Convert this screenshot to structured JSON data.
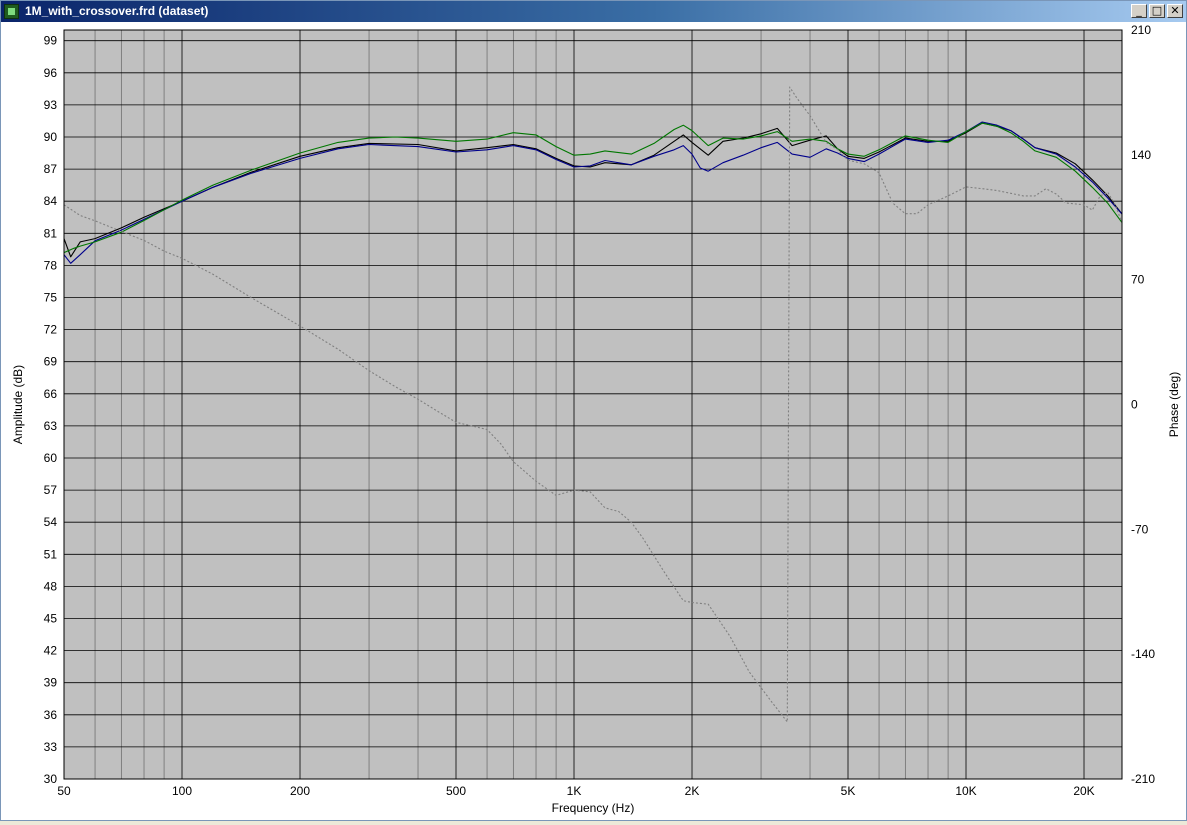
{
  "window": {
    "title": "1M_with_crossover.frd (dataset)",
    "controls": {
      "minimize": "_",
      "maximize": "□",
      "close": "✕"
    }
  },
  "colors": {
    "plot_background": "#c0c0c0",
    "grid": "#000000",
    "series_black": "#000000",
    "series_blue": "#00008b",
    "series_green": "#007700",
    "phase": "#808080"
  },
  "chart_data": {
    "type": "line",
    "xscale": "log",
    "xlabel": "Frequency (Hz)",
    "ylabel": "Amplitude (dB)",
    "y2label": "Phase (deg)",
    "xlim": [
      50,
      25000
    ],
    "ylim": [
      30,
      100
    ],
    "y2lim": [
      -210,
      210
    ],
    "grid": true,
    "x_ticks": [
      {
        "v": 50,
        "label": "50"
      },
      {
        "v": 100,
        "label": "100"
      },
      {
        "v": 200,
        "label": "200"
      },
      {
        "v": 500,
        "label": "500"
      },
      {
        "v": 1000,
        "label": "1K"
      },
      {
        "v": 2000,
        "label": "2K"
      },
      {
        "v": 5000,
        "label": "5K"
      },
      {
        "v": 10000,
        "label": "10K"
      },
      {
        "v": 20000,
        "label": "20K"
      }
    ],
    "x_minor": [
      60,
      70,
      80,
      90,
      300,
      400,
      600,
      700,
      800,
      900,
      3000,
      4000,
      6000,
      7000,
      8000,
      9000
    ],
    "y_ticks": [
      30,
      33,
      36,
      39,
      42,
      45,
      48,
      51,
      54,
      57,
      60,
      63,
      66,
      69,
      72,
      75,
      78,
      81,
      84,
      87,
      90,
      93,
      96,
      99
    ],
    "y2_ticks": [
      -210,
      -140,
      -70,
      0,
      70,
      140,
      210
    ],
    "series": [
      {
        "key": "black",
        "dashed": false,
        "points": [
          [
            50,
            80.5
          ],
          [
            52,
            78.8
          ],
          [
            55,
            80.2
          ],
          [
            60,
            80.5
          ],
          [
            70,
            81.5
          ],
          [
            80,
            82.5
          ],
          [
            90,
            83.3
          ],
          [
            100,
            84.0
          ],
          [
            120,
            85.3
          ],
          [
            150,
            86.7
          ],
          [
            200,
            88.2
          ],
          [
            250,
            89.0
          ],
          [
            300,
            89.4
          ],
          [
            400,
            89.3
          ],
          [
            500,
            88.7
          ],
          [
            600,
            89.0
          ],
          [
            700,
            89.3
          ],
          [
            800,
            88.9
          ],
          [
            900,
            88.0
          ],
          [
            1000,
            87.3
          ],
          [
            1100,
            87.2
          ],
          [
            1200,
            87.6
          ],
          [
            1400,
            87.4
          ],
          [
            1600,
            88.3
          ],
          [
            1800,
            89.6
          ],
          [
            1900,
            90.2
          ],
          [
            2000,
            89.5
          ],
          [
            2200,
            88.3
          ],
          [
            2400,
            89.6
          ],
          [
            2700,
            89.9
          ],
          [
            3000,
            90.3
          ],
          [
            3300,
            90.8
          ],
          [
            3600,
            89.2
          ],
          [
            4000,
            89.7
          ],
          [
            4400,
            90.1
          ],
          [
            4700,
            88.9
          ],
          [
            5000,
            88.2
          ],
          [
            5500,
            88.0
          ],
          [
            6000,
            88.6
          ],
          [
            7000,
            89.9
          ],
          [
            8000,
            89.6
          ],
          [
            9000,
            89.6
          ],
          [
            10000,
            90.4
          ],
          [
            11000,
            91.3
          ],
          [
            12000,
            91.0
          ],
          [
            13000,
            90.6
          ],
          [
            14000,
            89.8
          ],
          [
            15000,
            89.0
          ],
          [
            17000,
            88.5
          ],
          [
            19000,
            87.5
          ],
          [
            21000,
            86.0
          ],
          [
            23000,
            84.5
          ],
          [
            25000,
            82.8
          ]
        ]
      },
      {
        "key": "blue",
        "dashed": false,
        "points": [
          [
            50,
            79.0
          ],
          [
            52,
            78.2
          ],
          [
            55,
            79.0
          ],
          [
            60,
            80.3
          ],
          [
            70,
            81.3
          ],
          [
            80,
            82.3
          ],
          [
            90,
            83.2
          ],
          [
            100,
            84.0
          ],
          [
            120,
            85.3
          ],
          [
            150,
            86.6
          ],
          [
            200,
            88.0
          ],
          [
            250,
            88.9
          ],
          [
            300,
            89.3
          ],
          [
            400,
            89.1
          ],
          [
            500,
            88.6
          ],
          [
            600,
            88.8
          ],
          [
            700,
            89.2
          ],
          [
            800,
            88.8
          ],
          [
            900,
            87.9
          ],
          [
            1000,
            87.2
          ],
          [
            1100,
            87.3
          ],
          [
            1200,
            87.8
          ],
          [
            1400,
            87.4
          ],
          [
            1600,
            88.2
          ],
          [
            1800,
            88.8
          ],
          [
            1900,
            89.2
          ],
          [
            2000,
            88.4
          ],
          [
            2100,
            87.1
          ],
          [
            2200,
            86.8
          ],
          [
            2400,
            87.6
          ],
          [
            2700,
            88.3
          ],
          [
            3000,
            89.0
          ],
          [
            3300,
            89.5
          ],
          [
            3600,
            88.4
          ],
          [
            4000,
            88.1
          ],
          [
            4400,
            88.9
          ],
          [
            4700,
            88.5
          ],
          [
            5000,
            88.0
          ],
          [
            5500,
            87.7
          ],
          [
            6000,
            88.4
          ],
          [
            7000,
            89.8
          ],
          [
            8000,
            89.5
          ],
          [
            9000,
            89.7
          ],
          [
            10000,
            90.5
          ],
          [
            11000,
            91.4
          ],
          [
            12000,
            91.1
          ],
          [
            13000,
            90.6
          ],
          [
            14000,
            89.8
          ],
          [
            15000,
            89.0
          ],
          [
            17000,
            88.4
          ],
          [
            19000,
            87.2
          ],
          [
            21000,
            85.8
          ],
          [
            23000,
            84.3
          ],
          [
            25000,
            82.8
          ]
        ]
      },
      {
        "key": "green",
        "dashed": false,
        "points": [
          [
            50,
            79.2
          ],
          [
            53,
            79.6
          ],
          [
            55,
            79.8
          ],
          [
            60,
            80.2
          ],
          [
            70,
            81.1
          ],
          [
            80,
            82.2
          ],
          [
            90,
            83.2
          ],
          [
            100,
            84.1
          ],
          [
            120,
            85.5
          ],
          [
            150,
            86.9
          ],
          [
            200,
            88.5
          ],
          [
            250,
            89.5
          ],
          [
            300,
            89.9
          ],
          [
            350,
            90.0
          ],
          [
            400,
            89.9
          ],
          [
            500,
            89.6
          ],
          [
            600,
            89.8
          ],
          [
            700,
            90.4
          ],
          [
            800,
            90.2
          ],
          [
            900,
            89.1
          ],
          [
            1000,
            88.3
          ],
          [
            1100,
            88.4
          ],
          [
            1200,
            88.7
          ],
          [
            1400,
            88.4
          ],
          [
            1600,
            89.4
          ],
          [
            1800,
            90.7
          ],
          [
            1900,
            91.1
          ],
          [
            2000,
            90.6
          ],
          [
            2200,
            89.2
          ],
          [
            2400,
            89.9
          ],
          [
            2700,
            89.8
          ],
          [
            3000,
            90.1
          ],
          [
            3300,
            90.5
          ],
          [
            3600,
            89.6
          ],
          [
            4000,
            89.8
          ],
          [
            4400,
            89.6
          ],
          [
            4700,
            88.9
          ],
          [
            5000,
            88.4
          ],
          [
            5500,
            88.2
          ],
          [
            6000,
            88.8
          ],
          [
            7000,
            90.1
          ],
          [
            8000,
            89.7
          ],
          [
            9000,
            89.5
          ],
          [
            10000,
            90.5
          ],
          [
            11000,
            91.3
          ],
          [
            12000,
            91.0
          ],
          [
            13000,
            90.4
          ],
          [
            14000,
            89.6
          ],
          [
            15000,
            88.7
          ],
          [
            17000,
            88.1
          ],
          [
            19000,
            86.8
          ],
          [
            21000,
            85.3
          ],
          [
            23000,
            83.8
          ],
          [
            25000,
            82.0
          ]
        ]
      },
      {
        "key": "phase",
        "dashed": true,
        "axis": "y2",
        "points": [
          [
            50,
            112
          ],
          [
            55,
            106
          ],
          [
            60,
            103
          ],
          [
            70,
            97
          ],
          [
            80,
            92
          ],
          [
            90,
            86
          ],
          [
            100,
            82
          ],
          [
            120,
            73
          ],
          [
            150,
            60
          ],
          [
            200,
            44
          ],
          [
            250,
            31
          ],
          [
            300,
            19
          ],
          [
            350,
            10
          ],
          [
            400,
            3
          ],
          [
            450,
            -4
          ],
          [
            500,
            -10
          ],
          [
            600,
            -14
          ],
          [
            650,
            -22
          ],
          [
            700,
            -32
          ],
          [
            800,
            -43
          ],
          [
            900,
            -51
          ],
          [
            1000,
            -48
          ],
          [
            1100,
            -49
          ],
          [
            1200,
            -58
          ],
          [
            1300,
            -60
          ],
          [
            1400,
            -66
          ],
          [
            1500,
            -75
          ],
          [
            1700,
            -94
          ],
          [
            1900,
            -110
          ],
          [
            2000,
            -111
          ],
          [
            2200,
            -112
          ],
          [
            2500,
            -130
          ],
          [
            2800,
            -150
          ],
          [
            3200,
            -167
          ],
          [
            3500,
            -178
          ],
          [
            3550,
            178
          ],
          [
            3700,
            172
          ],
          [
            4000,
            162
          ],
          [
            4400,
            147
          ],
          [
            4700,
            143
          ],
          [
            5000,
            137
          ],
          [
            5500,
            135
          ],
          [
            6000,
            130
          ],
          [
            6500,
            113
          ],
          [
            7000,
            107
          ],
          [
            7500,
            107
          ],
          [
            8000,
            112
          ],
          [
            9000,
            117
          ],
          [
            10000,
            122
          ],
          [
            11000,
            121
          ],
          [
            12000,
            120
          ],
          [
            14000,
            117
          ],
          [
            15000,
            117
          ],
          [
            16000,
            121
          ],
          [
            17000,
            118
          ],
          [
            18000,
            113
          ],
          [
            20000,
            112
          ],
          [
            21000,
            109
          ],
          [
            22000,
            117
          ],
          [
            23000,
            119
          ],
          [
            24000,
            112
          ],
          [
            25000,
            102
          ]
        ]
      }
    ]
  }
}
